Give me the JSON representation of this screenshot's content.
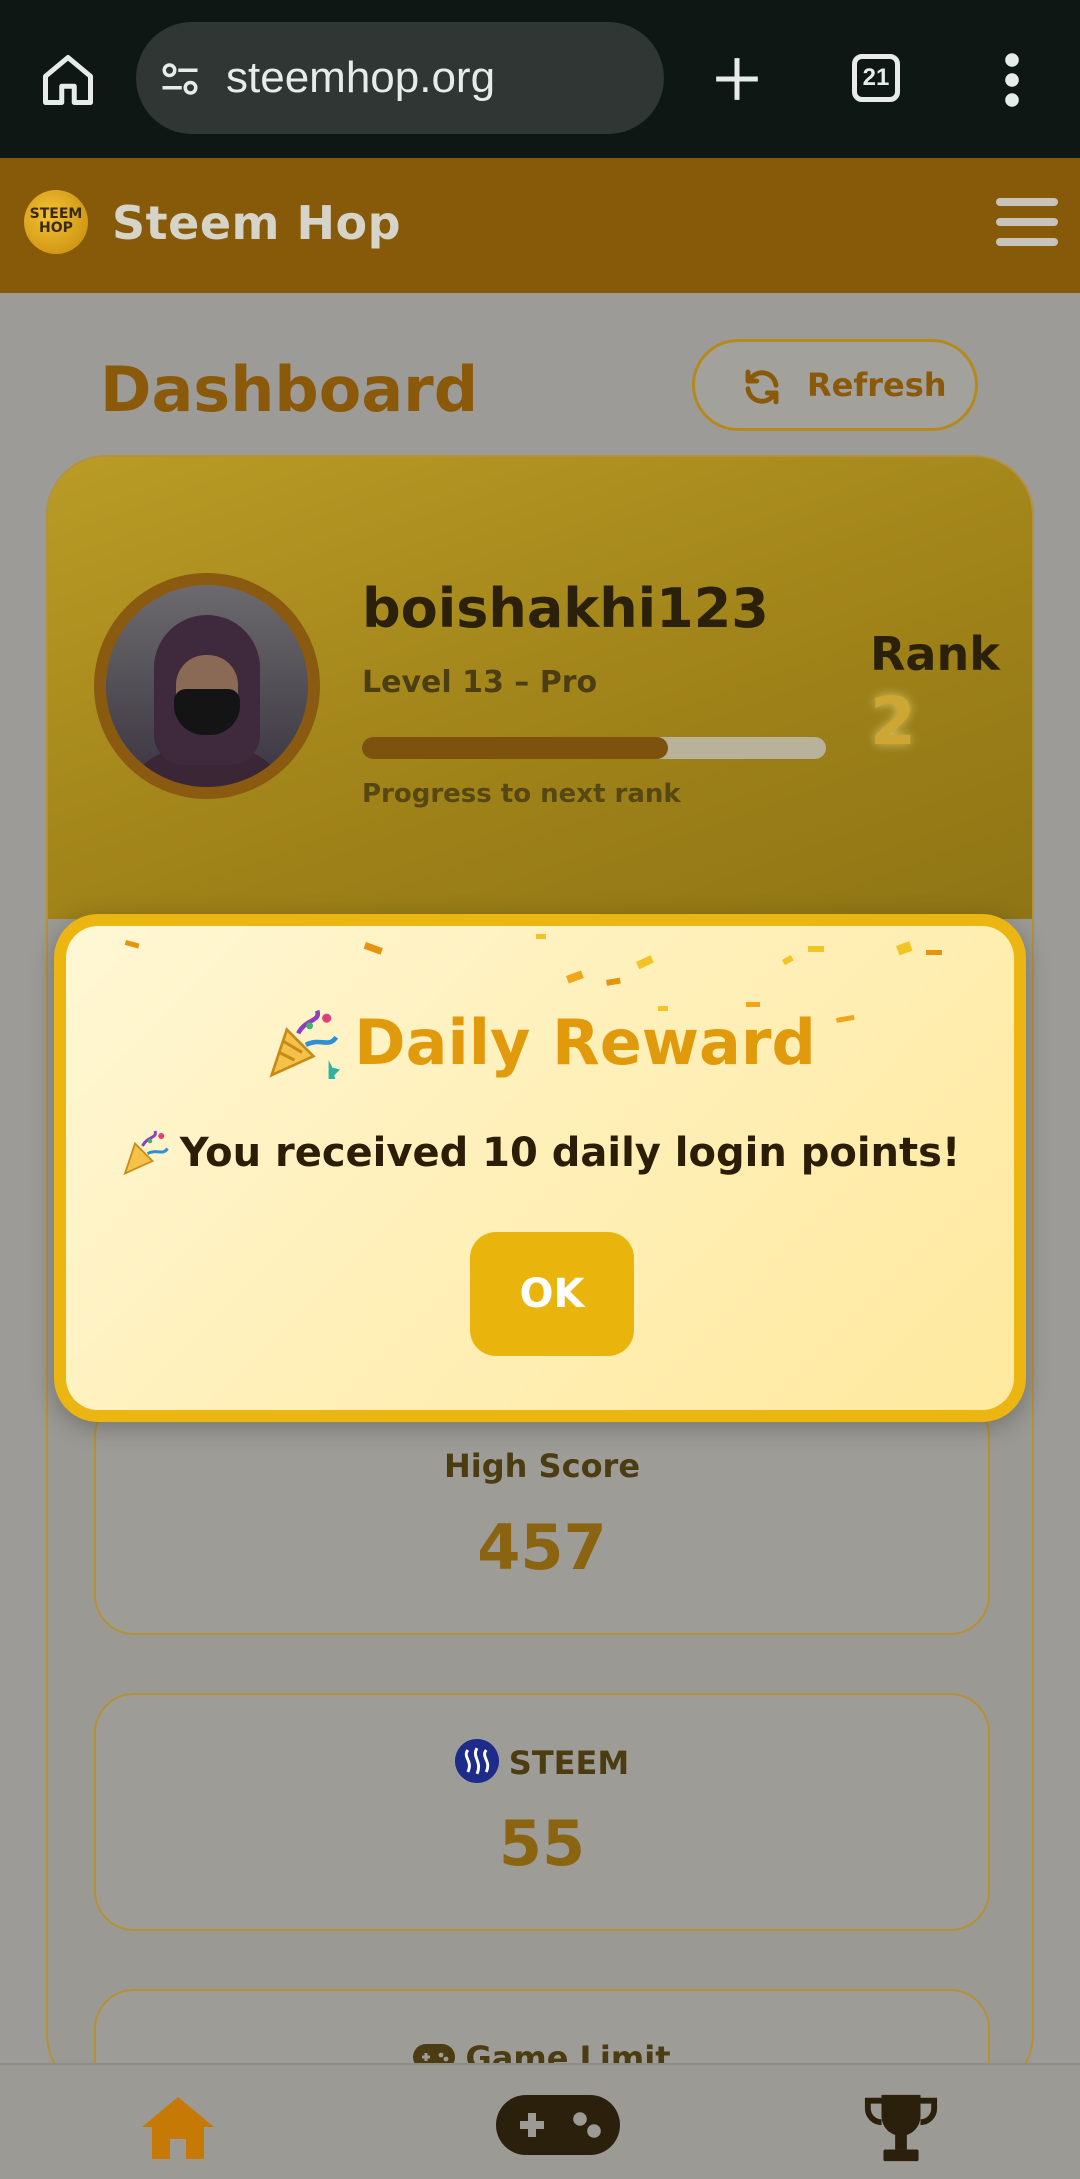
{
  "browser": {
    "url": "steemhop.org",
    "tab_count": "21"
  },
  "header": {
    "brand": "Steem Hop",
    "logo_text": "STEEM HOP"
  },
  "dashboard": {
    "title": "Dashboard",
    "refresh_label": "Refresh"
  },
  "profile": {
    "username": "boishakhi123",
    "level": "Level 13 – Pro",
    "progress_fraction": 0.66,
    "progress_label": "Progress to next rank",
    "rank_label": "Rank",
    "rank_value": "2"
  },
  "stats": {
    "high_score_label": "High Score",
    "high_score_value": "457",
    "steem_label": "STEEM",
    "steem_value": "55",
    "game_limit_label": "Game Limit"
  },
  "modal": {
    "title": "Daily Reward",
    "message": "You received 10 daily login points!",
    "ok_label": "OK"
  },
  "colors": {
    "accent": "#e9b40c",
    "header": "#875a09",
    "title": "#8a5a0a"
  },
  "icons": [
    "home-icon",
    "site-settings-icon",
    "plus-icon",
    "tabs-icon",
    "more-icon",
    "menu-icon",
    "refresh-icon",
    "party-popper-icon",
    "steem-icon",
    "gamepad-icon",
    "trophy-icon"
  ]
}
